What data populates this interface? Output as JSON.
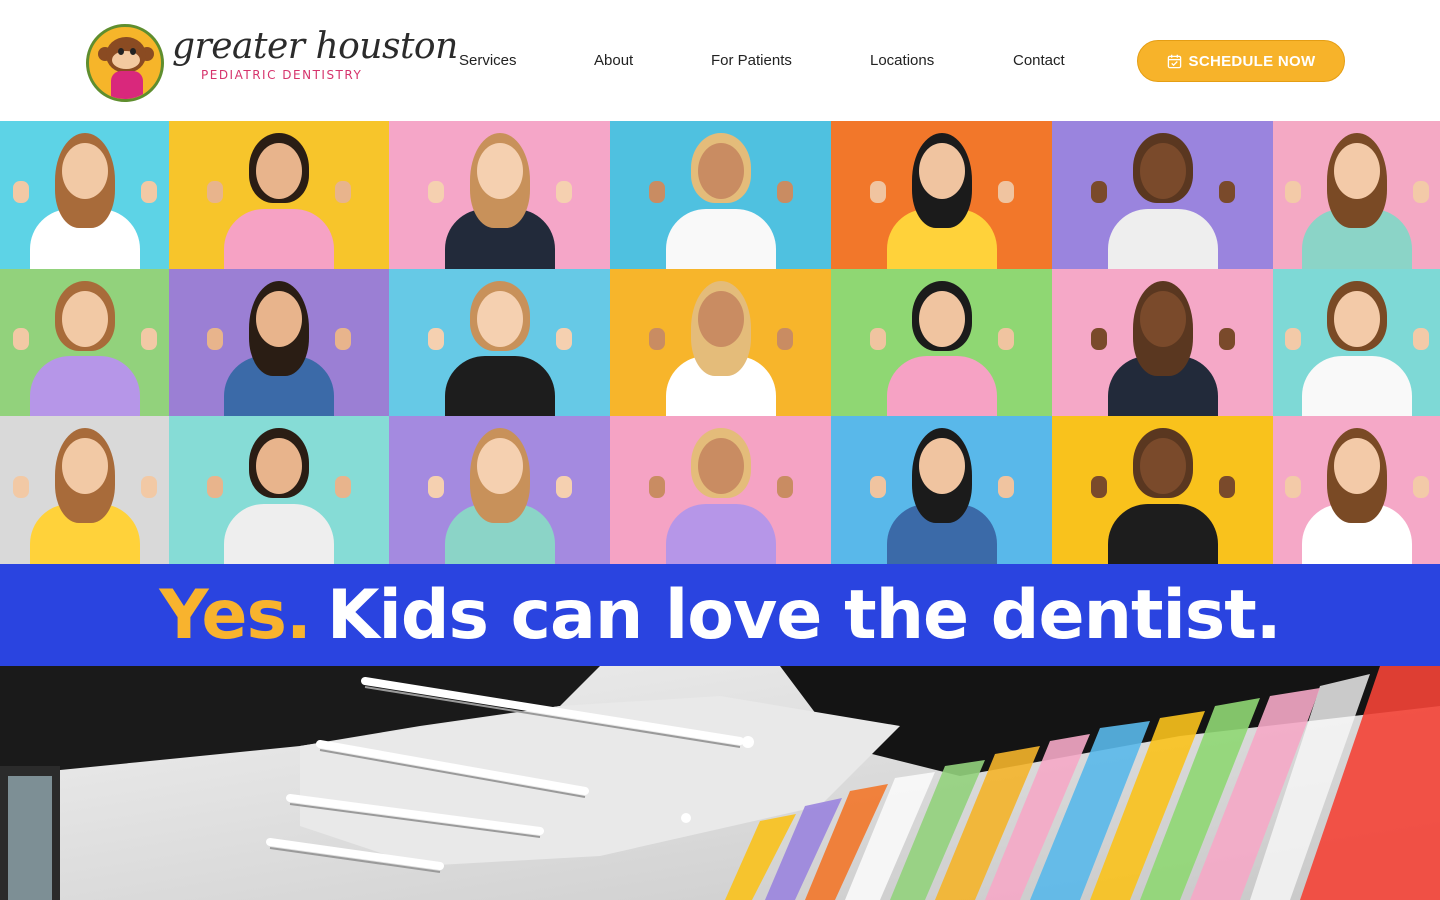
{
  "header": {
    "logo_title": "greater houston",
    "logo_subtitle": "PEDIATRIC DENTISTRY",
    "nav": [
      {
        "label": "Services"
      },
      {
        "label": "About"
      },
      {
        "label": "For Patients"
      },
      {
        "label": "Locations"
      },
      {
        "label": "Contact"
      }
    ],
    "cta_label": "SCHEDULE NOW",
    "cta_icon": "calendar-icon"
  },
  "hero": {
    "tile_backgrounds": [
      "#5dd3e6",
      "#f7c52b",
      "#f5a6c8",
      "#4fc1e0",
      "#f2772a",
      "#9a84de",
      "#f4a9c4",
      "#92d27c",
      "#9b7fd4",
      "#66c9e6",
      "#f7b52b",
      "#8fd773",
      "#f5a8c7",
      "#7ed9d6",
      "#d9d9d9",
      "#86dcd6",
      "#a48ae0",
      "#f5a3c4",
      "#59b8ea",
      "#f9c21c",
      "#f5a8c7"
    ]
  },
  "banner": {
    "highlight": "Yes.",
    "text": "Kids can love the dentist."
  },
  "colors": {
    "accent": "#f7b32a",
    "banner_bg": "#2a44e0",
    "brand_pink": "#d6336c"
  }
}
